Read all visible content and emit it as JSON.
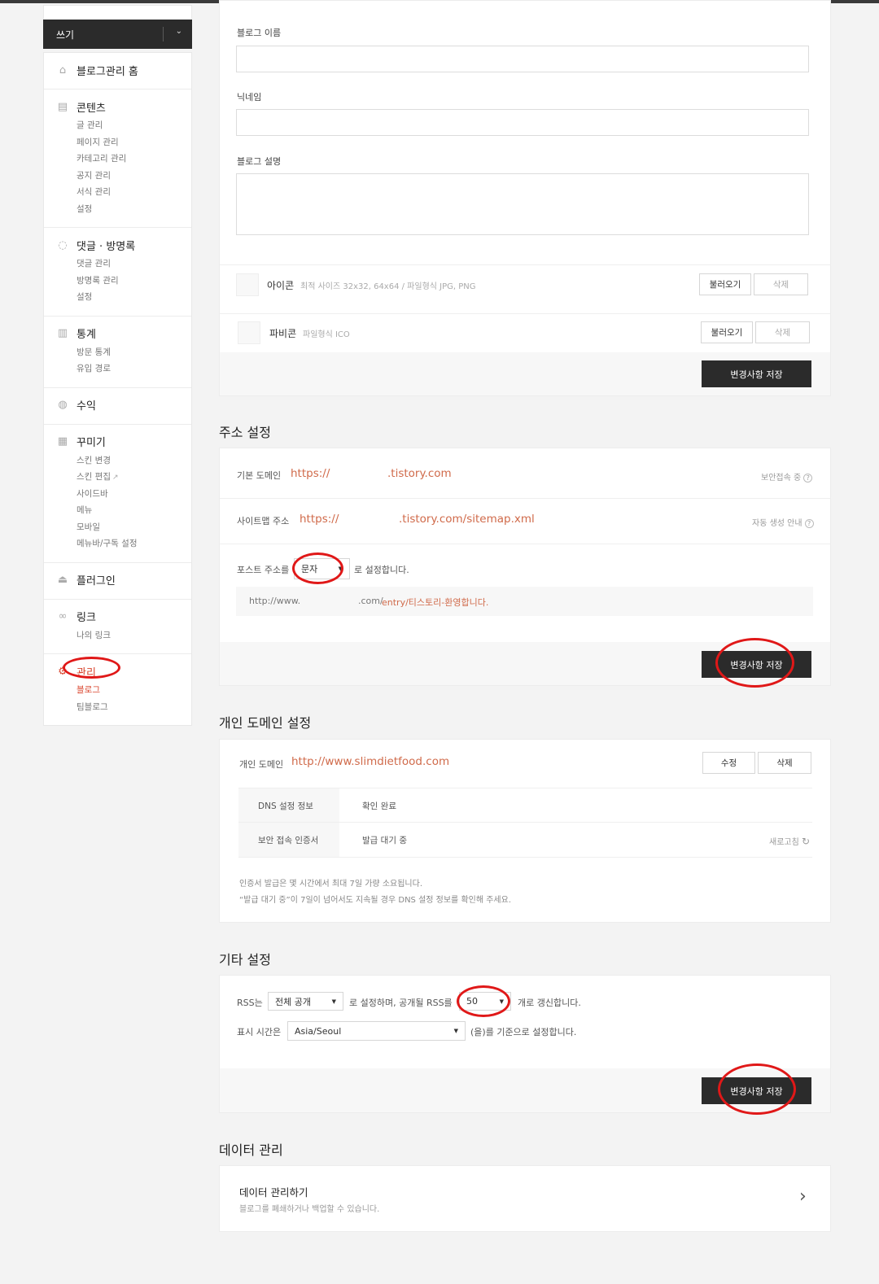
{
  "sidebar": {
    "write_label": "쓰기",
    "sections": [
      {
        "title": "블로그관리 홈",
        "icon": "home-icon",
        "items": []
      },
      {
        "title": "콘텐츠",
        "icon": "document-icon",
        "items": [
          "글 관리",
          "페이지 관리",
          "카테고리 관리",
          "공지 관리",
          "서식 관리",
          "설정"
        ]
      },
      {
        "title": "댓글 · 방명록",
        "icon": "comment-icon",
        "items": [
          "댓글 관리",
          "방명록 관리",
          "설정"
        ]
      },
      {
        "title": "통계",
        "icon": "chart-icon",
        "items": [
          "방문 통계",
          "유입 경로"
        ]
      },
      {
        "title": "수익",
        "icon": "revenue-icon",
        "items": []
      },
      {
        "title": "꾸미기",
        "icon": "layout-icon",
        "items": [
          "스킨 변경",
          "스킨 편집",
          "사이드바",
          "메뉴",
          "모바일",
          "메뉴바/구독 설정"
        ]
      },
      {
        "title": "플러그인",
        "icon": "plugin-icon",
        "items": []
      },
      {
        "title": "링크",
        "icon": "link-icon",
        "items": [
          "나의 링크"
        ]
      },
      {
        "title": "관리",
        "icon": "gear-icon",
        "items": [
          "블로그",
          "팀블로그"
        ]
      }
    ]
  },
  "blog_info": {
    "name_label": "블로그 이름",
    "nickname_label": "닉네임",
    "desc_label": "블로그 설명",
    "icon_label": "아이콘",
    "icon_hint": "최적 사이즈 32x32, 64x64 / 파일형식 JPG, PNG",
    "favicon_label": "파비콘",
    "favicon_hint": "파일형식 ICO",
    "load_label": "불러오기",
    "delete_label": "삭제",
    "save_label": "변경사항 저장"
  },
  "address": {
    "title": "주소 설정",
    "default_domain_label": "기본 도메인",
    "default_domain_prefix": "https://",
    "default_domain_suffix": ".tistory.com",
    "secure_label": "보안접속 중",
    "sitemap_label": "사이트맵 주소",
    "sitemap_prefix": "https://",
    "sitemap_suffix": ".tistory.com/sitemap.xml",
    "sitemap_help": "자동 생성 안내",
    "post_addr_prefix": "포스트 주소를",
    "post_addr_value": "문자",
    "post_addr_suffix": "로 설정합니다.",
    "example_prefix": "http://www.",
    "example_mid": ".com/",
    "example_path": "entry/티스토리-환영합니다.",
    "save_label": "변경사항 저장"
  },
  "personal_domain": {
    "title": "개인 도메인 설정",
    "domain_label": "개인 도메인",
    "domain_value": "http://www.slimdietfood.com",
    "edit_label": "수정",
    "delete_label": "삭제",
    "dns_label": "DNS 설정 정보",
    "dns_value": "확인 완료",
    "cert_label": "보안 접속 인증서",
    "cert_value": "발급 대기 중",
    "refresh_label": "새로고침",
    "note1": "인증서 발급은 몇 시간에서 최대 7일 가량 소요됩니다.",
    "note2": "“발급 대기 중”이 7일이 넘어서도 지속될 경우 DNS 설정 정보를 확인해 주세요."
  },
  "other": {
    "title": "기타 설정",
    "rss_prefix": "RSS는",
    "rss_value": "전체 공개",
    "rss_mid": "로 설정하며, 공개될 RSS를",
    "rss_count": "50",
    "rss_suffix": "개로 갱신합니다.",
    "time_prefix": "표시 시간은",
    "time_value": "Asia/Seoul",
    "time_suffix": "(을)를 기준으로 설정합니다.",
    "save_label": "변경사항 저장"
  },
  "data": {
    "title": "데이터 관리",
    "item_title": "데이터 관리하기",
    "item_desc": "블로그를 폐쇄하거나 백업할 수 있습니다."
  },
  "colors": {
    "accent": "#d9452e",
    "link": "#d06a4a",
    "dark": "#2b2b2b",
    "annotation": "#e01818"
  }
}
